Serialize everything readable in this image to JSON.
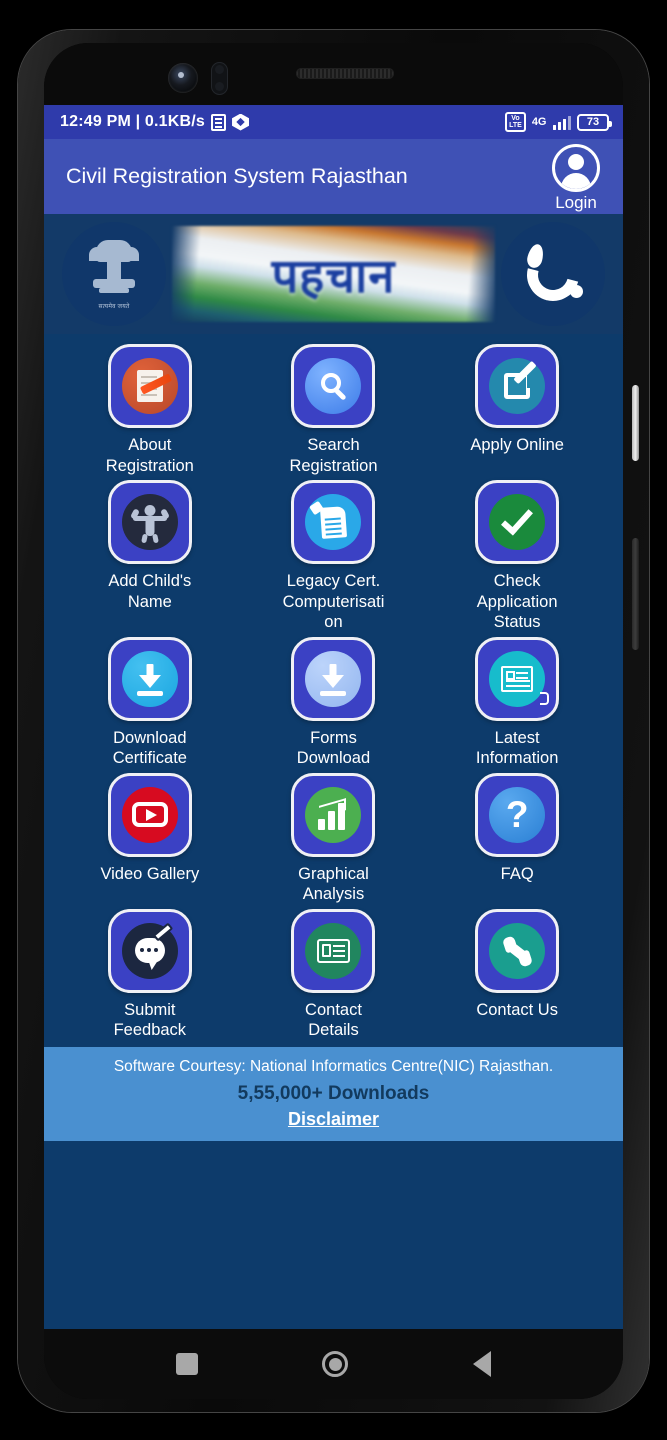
{
  "statusbar": {
    "time_and_speed": "12:49 PM | 0.1KB/s",
    "doc_icon": "document-icon",
    "sync_icon": "sync-icon",
    "volte_top": "Vo",
    "volte_bottom": "LTE",
    "network": "4G",
    "battery": "73"
  },
  "appbar": {
    "title": "Civil Registration System Rajasthan",
    "login_label": "Login"
  },
  "banner": {
    "emblem_motto": "सत्यमेव जयते",
    "flag_text": "पहचान"
  },
  "grid": {
    "items": [
      {
        "label": "About Registration",
        "icon": "document-pen-icon"
      },
      {
        "label": "Search Registration",
        "icon": "magnifier-icon"
      },
      {
        "label": "Apply Online",
        "icon": "edit-square-icon"
      },
      {
        "label": "Add Child's Name",
        "icon": "child-icon"
      },
      {
        "label": "Legacy Cert. Computerisation",
        "icon": "certificate-icon"
      },
      {
        "label": "Check Application Status",
        "icon": "checkmark-icon"
      },
      {
        "label": "Download Certificate",
        "icon": "download-icon"
      },
      {
        "label": "Forms Download",
        "icon": "download-forms-icon"
      },
      {
        "label": "Latest Information",
        "icon": "newspaper-icon"
      },
      {
        "label": "Video Gallery",
        "icon": "youtube-play-icon"
      },
      {
        "label": "Graphical Analysis",
        "icon": "bar-chart-icon"
      },
      {
        "label": "FAQ",
        "icon": "question-mark-icon"
      },
      {
        "label": "Submit Feedback",
        "icon": "feedback-bubble-icon"
      },
      {
        "label": "Contact Details",
        "icon": "id-card-icon"
      },
      {
        "label": "Contact Us",
        "icon": "phone-icon"
      }
    ]
  },
  "footer": {
    "courtesy": "Software Courtesy: National Informatics Centre(NIC) Rajasthan.",
    "downloads": "5,55,000+ Downloads",
    "disclaimer": "Disclaimer"
  },
  "navbar": {
    "recents": "recents-icon",
    "home": "home-icon",
    "back": "back-icon"
  },
  "colors": {
    "statusbar": "#2f3bab",
    "appbar": "#3f51b5",
    "screen_bg": "#0d3b6b",
    "banner_bg": "#133a68",
    "tile_bg": "#3b41c4",
    "footer_bg": "#4a90d0"
  }
}
